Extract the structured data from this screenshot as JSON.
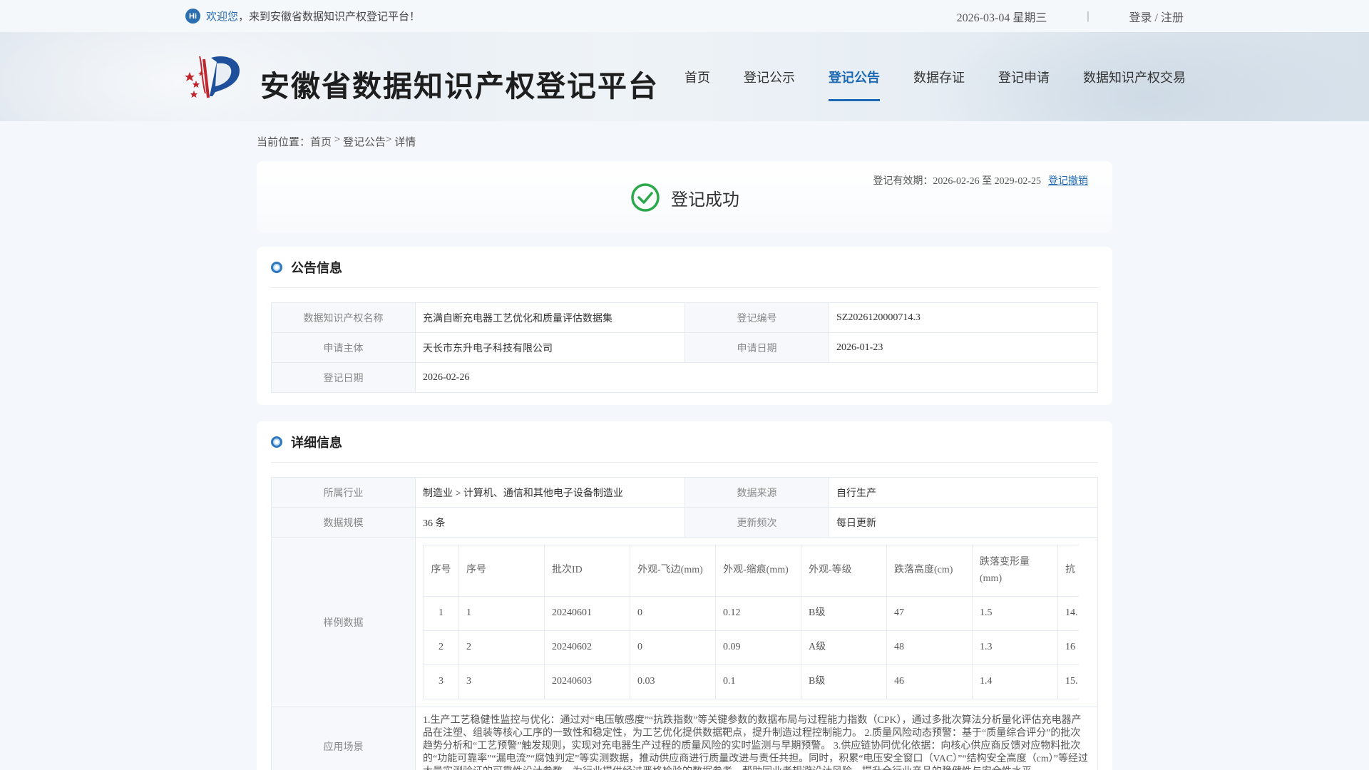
{
  "topbar": {
    "hi": "Hi",
    "welcome_highlight": "欢迎您",
    "welcome_rest": "，来到安徽省数据知识产权登记平台！",
    "date": "2026-03-04 星期三",
    "separator": "|",
    "login": "登录 / 注册"
  },
  "header": {
    "site_title": "安徽省数据知识产权登记平台",
    "nav": [
      "首页",
      "登记公示",
      "登记公告",
      "数据存证",
      "登记申请",
      "数据知识产权交易"
    ],
    "active_nav": "登记公告"
  },
  "breadcrumb": {
    "prefix": "当前位置：",
    "home": "首页",
    "sep1": " > ",
    "section": "登记公告",
    "sep2": "> ",
    "current": "详情"
  },
  "status": {
    "text": "登记成功",
    "validity": "登记有效期：2026-02-26 至 2029-02-25",
    "revoke": "登记撤销"
  },
  "notice": {
    "title": "公告信息",
    "name_label": "数据知识产权名称",
    "name_value": "充满自断充电器工艺优化和质量评估数据集",
    "code_label": "登记编号",
    "code_value": "SZ2026120000714.3",
    "applicant_label": "申请主体",
    "applicant_value": "天长市东升电子科技有限公司",
    "apply_date_label": "申请日期",
    "apply_date_value": "2026-01-23",
    "reg_date_label": "登记日期",
    "reg_date_value": "2026-02-26"
  },
  "detail": {
    "title": "详细信息",
    "industry_label": "所属行业",
    "industry_value": "制造业 > 计算机、通信和其他电子设备制造业",
    "source_label": "数据来源",
    "source_value": "自行生产",
    "scale_label": "数据规模",
    "scale_value": "36 条",
    "freq_label": "更新频次",
    "freq_value": "每日更新",
    "sample_label": "样例数据",
    "sample_headers": [
      "序号",
      "序号",
      "批次ID",
      "外观-飞边(mm)",
      "外观-缩痕(mm)",
      "外观-等级",
      "跌落高度(cm)",
      "跌落变形量(mm)",
      "抗"
    ],
    "sample_rows": [
      [
        "1",
        "1",
        "20240601",
        "0",
        "0.12",
        "B级",
        "47",
        "1.5",
        "14."
      ],
      [
        "2",
        "2",
        "20240602",
        "0",
        "0.09",
        "A级",
        "48",
        "1.3",
        "16"
      ],
      [
        "3",
        "3",
        "20240603",
        "0.03",
        "0.1",
        "B级",
        "46",
        "1.4",
        "15."
      ]
    ],
    "scenario_label": "应用场景",
    "scenario_text": "1.生产工艺稳健性监控与优化：通过对“电压敏感度”“抗跌指数”等关键参数的数据布局与过程能力指数（CPK），通过多批次算法分析量化评估充电器产品在注塑、组装等核心工序的一致性和稳定性，为工艺优化提供数据靶点，提升制造过程控制能力。 2.质量风险动态预警：基于“质量综合评分”的批次趋势分析和“工艺预警”触发规则，实现对充电器生产过程的质量风险的实时监测与早期预警。 3.供应链协同优化依据：向核心供应商反馈对应物料批次的“功能可靠率”“漏电流”“腐蚀判定”等实测数据，推动供应商进行质量改进与责任共担。同时，积累“电压安全窗口（VAC）”“结构安全高度（cm）”等经过大量实测验证的可靠性设计参数，为行业提供经过严格检验的数据参考，帮助同业者规避设计风险，提升全行业产品的稳健性与安全性水平。"
  },
  "colors": {
    "accent": "#1d68b3",
    "success": "#2aa84a"
  }
}
